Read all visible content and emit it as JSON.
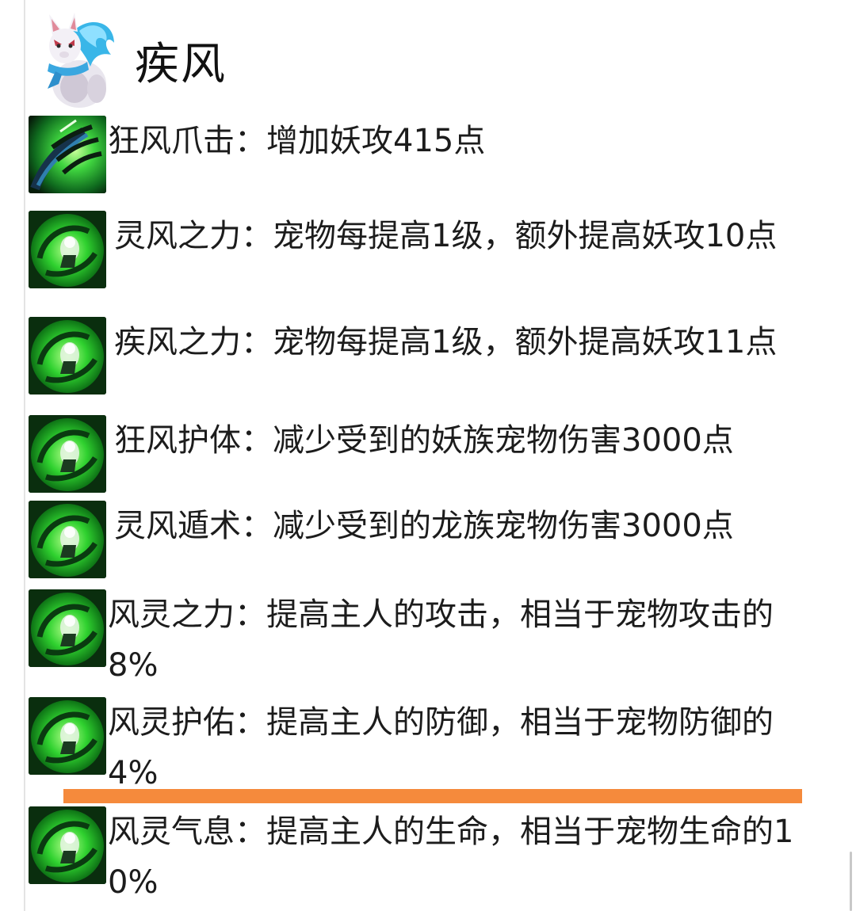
{
  "pet": {
    "name": "疾风",
    "avatar_icon": "white-fox-pet-icon"
  },
  "skills": [
    {
      "icon": "claw-strike-icon",
      "name": "狂风爪击",
      "desc": "增加妖攻415点"
    },
    {
      "icon": "green-orb-skill-icon",
      "name": "灵风之力",
      "desc": "宠物每提高1级，额外提高妖攻10点"
    },
    {
      "icon": "green-orb-skill-icon",
      "name": "疾风之力",
      "desc": "宠物每提高1级，额外提高妖攻11点"
    },
    {
      "icon": "green-orb-skill-icon",
      "name": "狂风护体",
      "desc": "减少受到的妖族宠物伤害3000点"
    },
    {
      "icon": "green-orb-skill-icon",
      "name": "灵风遁术",
      "desc": "减少受到的龙族宠物伤害3000点"
    },
    {
      "icon": "green-orb-skill-icon",
      "name": "风灵之力",
      "desc": "提高主人的攻击，相当于宠物攻击的8%"
    },
    {
      "icon": "green-orb-skill-icon",
      "name": "风灵护佑",
      "desc": "提高主人的防御，相当于宠物防御的4%"
    },
    {
      "icon": "green-orb-skill-icon",
      "name": "风灵气息",
      "desc": "提高主人的生命，相当于宠物生命的10%"
    }
  ],
  "colors": {
    "divider": "#f58a3c",
    "skill_green": "#2fd12f"
  }
}
